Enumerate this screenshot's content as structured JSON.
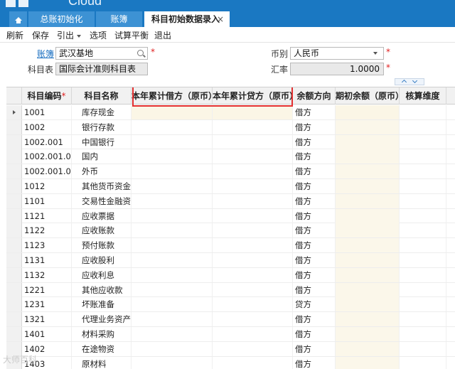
{
  "app": {
    "brand_text": "Cloud"
  },
  "tabs": [
    {
      "label": "总账初始化"
    },
    {
      "label": "账簿"
    },
    {
      "label": "科目初始数据录入",
      "close": "×"
    }
  ],
  "toolbar": {
    "refresh": "刷新",
    "save": "保存",
    "import": "引出",
    "options": "选项",
    "trial_balance": "试算平衡",
    "exit": "退出"
  },
  "form": {
    "book_label": "账簿",
    "book_value": "武汉基地",
    "chart_label": "科目表",
    "chart_value": "国际会计准则科目表",
    "currency_label": "币别",
    "currency_value": "人民币",
    "rate_label": "汇率",
    "rate_value": "1.0000",
    "required_mark": "*"
  },
  "grid": {
    "headers": {
      "code": "科目编码",
      "name": "科目名称",
      "debit": "本年累计借方（原币）",
      "credit": "本年累计贷方（原币）",
      "direction": "余额方向",
      "opening": "期初余额（原币）",
      "dimension": "核算维度"
    },
    "rows": [
      {
        "code": "1001",
        "name": "库存现金",
        "direction": "借方"
      },
      {
        "code": "1002",
        "name": "银行存款",
        "direction": "借方"
      },
      {
        "code": "1002.001",
        "name": "中国银行",
        "direction": "借方"
      },
      {
        "code": "1002.001.01",
        "name": "国内",
        "direction": "借方"
      },
      {
        "code": "1002.001.01.0",
        "name": "外币",
        "direction": "借方"
      },
      {
        "code": "1012",
        "name": "其他货币资金",
        "direction": "借方"
      },
      {
        "code": "1101",
        "name": "交易性金融资产",
        "direction": "借方"
      },
      {
        "code": "1121",
        "name": "应收票据",
        "direction": "借方"
      },
      {
        "code": "1122",
        "name": "应收账款",
        "direction": "借方"
      },
      {
        "code": "1123",
        "name": "预付账款",
        "direction": "借方"
      },
      {
        "code": "1131",
        "name": "应收股利",
        "direction": "借方"
      },
      {
        "code": "1132",
        "name": "应收利息",
        "direction": "借方"
      },
      {
        "code": "1221",
        "name": "其他应收款",
        "direction": "借方"
      },
      {
        "code": "1231",
        "name": "坏账准备",
        "direction": "贷方"
      },
      {
        "code": "1321",
        "name": "代理业务资产",
        "direction": "借方"
      },
      {
        "code": "1401",
        "name": "材料采购",
        "direction": "借方"
      },
      {
        "code": "1402",
        "name": "在途物资",
        "direction": "借方"
      },
      {
        "code": "1403",
        "name": "原材料",
        "direction": "借方"
      }
    ]
  },
  "watermark": "大师百科",
  "colors": {
    "brand": "#1a78c2",
    "highlight": "#e33030",
    "required": "#e02020"
  }
}
